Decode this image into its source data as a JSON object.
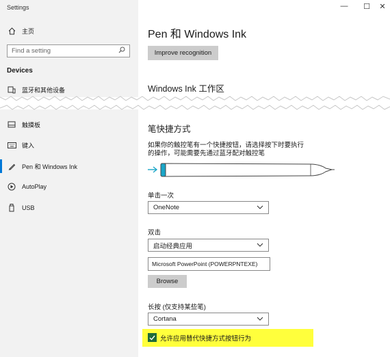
{
  "window": {
    "title": "Settings",
    "minimize_glyph": "—",
    "maximize_glyph": "☐",
    "close_glyph": "✕"
  },
  "sidebar": {
    "home_label": "主页",
    "search": {
      "placeholder": "Find a setting",
      "icon": "search-icon"
    },
    "section_label": "Devices",
    "items": [
      {
        "label": "蓝牙和其他设备",
        "icon": "bluetooth-devices-icon"
      },
      {
        "label": "触摸板",
        "icon": "touchpad-icon"
      },
      {
        "label": "键入",
        "icon": "keyboard-icon"
      },
      {
        "label": "Pen 和 Windows Ink",
        "icon": "pen-icon",
        "active": true
      },
      {
        "label": "AutoPlay",
        "icon": "autoplay-icon"
      },
      {
        "label": "USB",
        "icon": "usb-icon"
      }
    ]
  },
  "main": {
    "title": "Pen 和 Windows Ink",
    "improve_button": "Improve recognition",
    "ink_workspace_heading": "Windows Ink 工作区",
    "pen_shortcuts_heading": "笔快捷方式",
    "pen_shortcuts_desc": "如果你的触控笔有一个快捷按钮，请选择按下时要执行的操作，可能需要先通过蓝牙配对触控笔",
    "single_click": {
      "label": "单击一次",
      "value": "OneNote"
    },
    "double_click": {
      "label": "双击",
      "value": "启动经典应用",
      "app_path": "Microsoft PowerPoint (POWERPNTEXE)",
      "browse_button": "Browse"
    },
    "press_hold": {
      "label": "长按 (仅支持某些笔)",
      "value": "Cortana"
    },
    "override_checkbox": {
      "label": "允许应用替代快捷方式按钮行为",
      "checked": true
    },
    "colors": {
      "accent": "#0078d7",
      "highlight": "#ffff3c",
      "checkbox": "#1e6b3a",
      "pen_tip": "#1aa6c8"
    }
  }
}
